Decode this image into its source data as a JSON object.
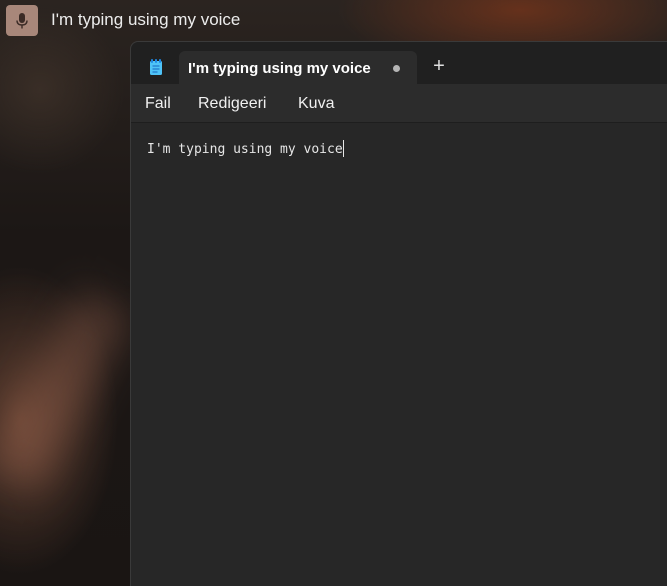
{
  "voice_typing": {
    "icon": "microphone-icon",
    "transcript": "I'm typing using my voice",
    "accent_color": "#a8877a"
  },
  "notepad": {
    "app_icon": "notepad-icon",
    "tab": {
      "title": "I'm typing using my voice",
      "unsaved_indicator": "dot-icon"
    },
    "new_tab_icon": "plus-icon",
    "new_tab_label": "+",
    "menu": [
      "Fail",
      "Redigeeri",
      "Kuva"
    ],
    "document_text": "I'm typing using my voice"
  }
}
